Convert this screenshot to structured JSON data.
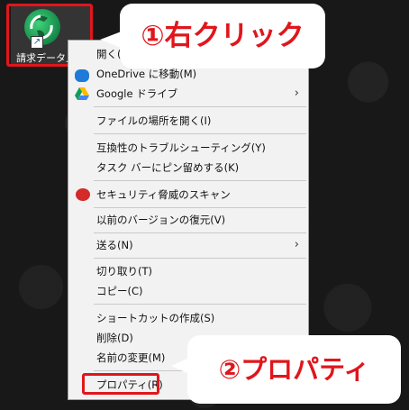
{
  "desktop": {
    "shortcut_label": "請求データ入力"
  },
  "menu": {
    "items": [
      {
        "label": "開く(O)"
      },
      {
        "label": "OneDrive に移動(M)",
        "icon": "onedrive-cloud-icon"
      },
      {
        "label": "Google ドライブ",
        "icon": "google-drive-icon",
        "submenu": true
      },
      {
        "label": "ファイルの場所を開く(I)"
      },
      {
        "label": "互換性のトラブルシューティング(Y)"
      },
      {
        "label": "タスク バーにピン留めする(K)"
      },
      {
        "label": "セキュリティ脅威のスキャン",
        "icon": "trend-micro-icon"
      },
      {
        "label": "以前のバージョンの復元(V)"
      },
      {
        "label": "送る(N)",
        "submenu": true
      },
      {
        "label": "切り取り(T)"
      },
      {
        "label": "コピー(C)"
      },
      {
        "label": "ショートカットの作成(S)"
      },
      {
        "label": "削除(D)"
      },
      {
        "label": "名前の変更(M)"
      },
      {
        "label": "プロパティ(R)"
      }
    ]
  },
  "callouts": {
    "step1": "①右クリック",
    "step2": "②プロパティ"
  },
  "colors": {
    "highlight_red": "#e0161c",
    "menu_bg": "#f2f2f2",
    "desktop_bg": "#161616"
  }
}
